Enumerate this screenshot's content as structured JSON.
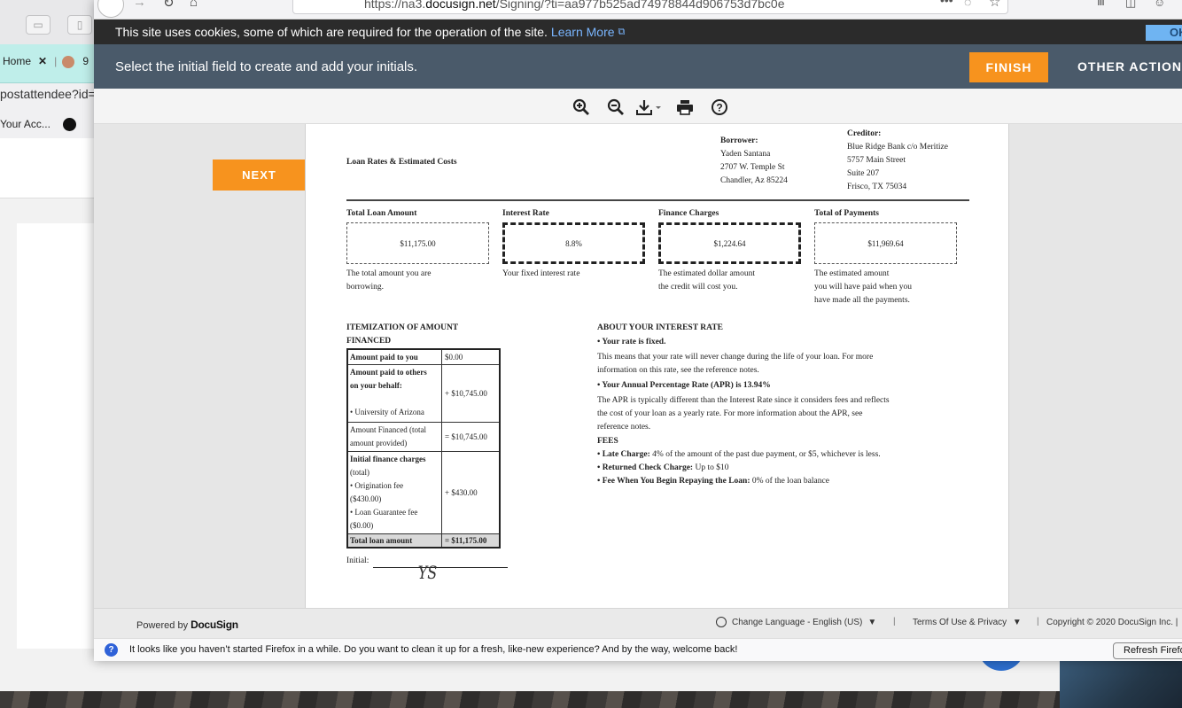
{
  "background_window": {
    "tab_home": "Home",
    "tab2_label": "9",
    "url_fragment": "postattendee?id=",
    "bookmark_label": "Your Acc..."
  },
  "browser": {
    "url_prefix": "https://na3.",
    "url_domain": "docusign.net",
    "url_path": "/Signing/?ti=aa977b525ad74978844d906753d7bc0e"
  },
  "cookie_banner": {
    "text": "This site uses cookies, some of which are required for the operation of the site.",
    "link": "Learn More",
    "ok_label": "OK"
  },
  "action_bar": {
    "message": "Select the initial field to create and add your initials.",
    "finish_label": "FINISH",
    "other_actions_label": "OTHER ACTIONS"
  },
  "doc_toolbar": {
    "icons": [
      "zoom-in-icon",
      "zoom-out-icon",
      "download-icon",
      "print-icon",
      "help-icon"
    ]
  },
  "next_label": "NEXT",
  "document": {
    "title": "Loan Rates & Estimated Costs",
    "borrower": {
      "heading": "Borrower:",
      "name": "Yaden Santana",
      "address1": "2707 W. Temple St",
      "address2": "Chandler, Az 85224"
    },
    "creditor": {
      "heading": "Creditor:",
      "name": "Blue Ridge Bank c/o Meritize",
      "address1": "5757 Main Street",
      "address2": "Suite 207",
      "address3": "Frisco, TX 75034"
    },
    "summary": [
      {
        "label": "Total Loan Amount",
        "value": "$11,175.00",
        "desc1": "The total amount you are",
        "desc2": "borrowing.",
        "desc3": ""
      },
      {
        "label": "Interest Rate",
        "value": "8.8%",
        "desc1": "Your fixed interest rate",
        "desc2": "",
        "desc3": ""
      },
      {
        "label": "Finance Charges",
        "value": "$1,224.64",
        "desc1": "The estimated dollar amount",
        "desc2": "the credit will cost you.",
        "desc3": ""
      },
      {
        "label": "Total of Payments",
        "value": "$11,969.64",
        "desc1": "The estimated amount",
        "desc2": "you will have paid when you",
        "desc3": "have made all the payments."
      }
    ],
    "itemization": {
      "heading1": "ITEMIZATION OF AMOUNT",
      "heading2": "FINANCED",
      "rows": {
        "paid_to_you": {
          "label": "Amount paid to you",
          "value": "$0.00"
        },
        "paid_to_others": {
          "label1": "Amount paid to others",
          "label2": "on your behalf:",
          "sub": "• University of Arizona",
          "value": "+ $10,745.00"
        },
        "amount_financed": {
          "label1": "Amount Financed (total",
          "label2": "amount provided)",
          "value": "= $10,745.00"
        },
        "finance_charges": {
          "label1": "Initial finance charges",
          "label2": "(total)",
          "sub1": "• Origination fee",
          "sub1b": "($430.00)",
          "sub2": "• Loan Guarantee fee",
          "sub2b": "($0.00)",
          "value": "+ $430.00"
        },
        "total": {
          "label": "Total loan amount",
          "value": "= $11,175.00"
        }
      }
    },
    "initial_label": "Initial:",
    "initials": "YS",
    "about": {
      "heading": "ABOUT YOUR INTEREST RATE",
      "fixed": "• Your rate is fixed.",
      "fixed_desc1": "This means that your rate will never change during the life of your loan. For more",
      "fixed_desc2": "information on this rate, see the reference notes.",
      "apr": "• Your Annual Percentage Rate (APR) is 13.94%",
      "apr_desc1": "The APR is typically different than the Interest Rate since it considers fees and reflects",
      "apr_desc2": "the cost of your loan as a yearly rate. For more information about the APR, see",
      "apr_desc3": "reference notes.",
      "fees_heading": "FEES",
      "late_label": "• Late Charge:",
      "late_text": "4% of the amount of the past due payment, or $5, whichever is less.",
      "check_label": "• Returned Check Charge:",
      "check_text": "Up to $10",
      "repay_label": "• Fee When You Begin Repaying the Loan:",
      "repay_text": "0% of the loan balance"
    }
  },
  "footer": {
    "powered_by": "Powered by",
    "brand": "DocuSign",
    "language": "Change Language - English (US)",
    "terms": "Terms Of Use & Privacy",
    "copyright": "Copyright © 2020 DocuSign Inc. |"
  },
  "firefox_notice": {
    "text": "It looks like you haven’t started Firefox in a while. Do you want to clean it up for a fresh, like-new experience? And by the way, welcome back!",
    "refresh_label": "Refresh Firefox"
  }
}
